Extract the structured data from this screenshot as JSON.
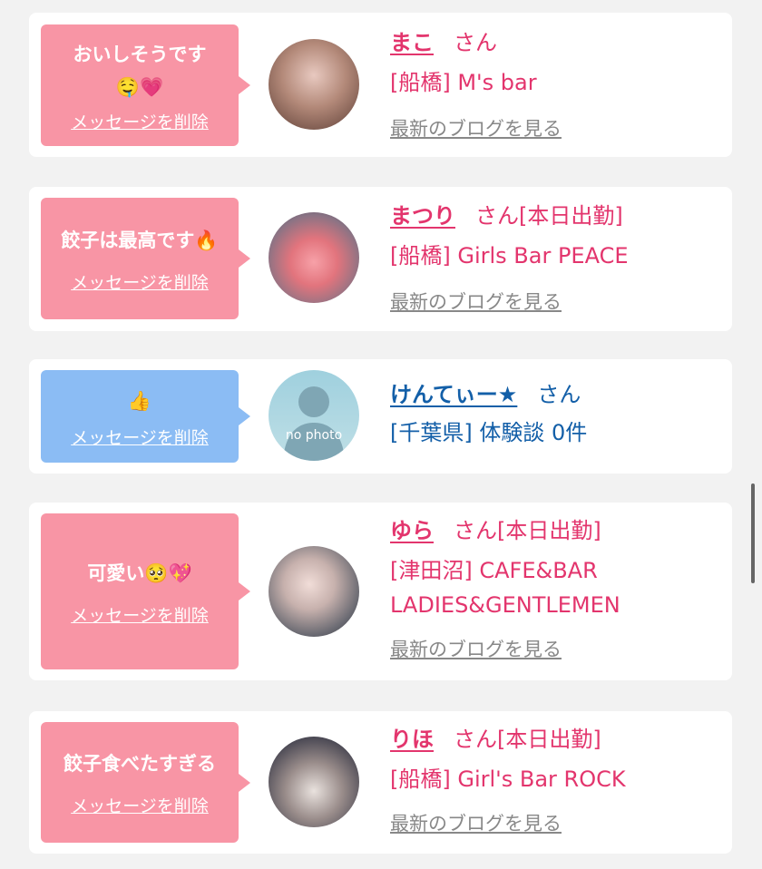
{
  "items": [
    {
      "message": "おいしそうです🤤💗",
      "delete_label": "メッセージを削除",
      "name": "まこ",
      "suffix": "さん",
      "shop": "[船橋] M's bar",
      "blog_label": "最新のブログを見る"
    },
    {
      "message": "餃子は最高です🔥",
      "delete_label": "メッセージを削除",
      "name": "まつり",
      "suffix": "さん[本日出勤]",
      "shop": "[船橋] Girls Bar PEACE",
      "blog_label": "最新のブログを見る"
    },
    {
      "message": "👍",
      "delete_label": "メッセージを削除",
      "name": "けんてぃー★",
      "suffix": "さん",
      "shop": "[千葉県] 体験談 0件",
      "avatar_text": "no photo"
    },
    {
      "message": "可愛い🥺💖",
      "delete_label": "メッセージを削除",
      "name": "ゆら",
      "suffix": "さん[本日出勤]",
      "shop": "[津田沼] CAFE&BAR LADIES&GENTLEMEN",
      "blog_label": "最新のブログを見る"
    },
    {
      "message": "餃子食べたすぎる",
      "delete_label": "メッセージを削除",
      "name": "りほ",
      "suffix": "さん[本日出勤]",
      "shop": "[船橋] Girl's Bar ROCK",
      "blog_label": "最新のブログを見る"
    }
  ],
  "colors": {
    "pink_bubble": "#f895a5",
    "blue_bubble": "#8bbcf4",
    "pink_text": "#e3356d",
    "blue_text": "#135fa8",
    "blog_gray": "#888888"
  }
}
